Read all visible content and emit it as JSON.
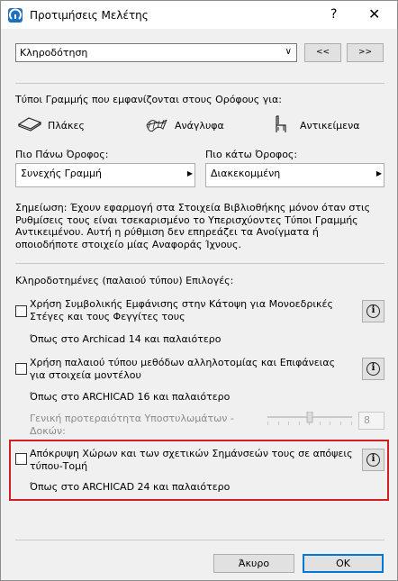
{
  "window": {
    "title": "Προτιμήσεις Μελέτης",
    "help_label": "?",
    "close_label": "✕"
  },
  "page_selector": {
    "value": "Κληροδότηση",
    "prev_label": "<<",
    "next_label": ">>"
  },
  "line_types": {
    "heading": "Τύποι Γραμμής που εμφανίζονται στους Ορόφους για:",
    "elements": [
      {
        "label": "Πλάκες",
        "icon": "slab-icon"
      },
      {
        "label": "Ανάγλυφα",
        "icon": "mesh-icon"
      },
      {
        "label": "Αντικείμενα",
        "icon": "object-icon"
      }
    ],
    "above_label": "Πιο Πάνω Όροφος:",
    "above_value": "Συνεχής Γραμμή",
    "below_label": "Πιο κάτω Όροφος:",
    "below_value": "Διακεκομμένη",
    "note": "Σημείωση: Έχουν εφαρμογή στα Στοιχεία Βιβλιοθήκης μόνον όταν στις Ρυθμίσεις τους είναι τσεκαρισμένο το Υπερισχύοντες Τύποι Γραμμής Αντικειμένου. Αυτή η ρύθμιση δεν επηρεάζει τα Ανοίγματα ή οποιοδήποτε στοιχείο μίας Αναφοράς Ίχνους."
  },
  "legacy": {
    "heading": "Κληροδοτημένες (παλαιού τύπου) Επιλογές:",
    "options": [
      {
        "label": "Χρήση Συμβολικής Εμφάνισης στην Κάτοψη για Μονοεδρικές Στέγες και τους Φεγγίτες τους",
        "version": "Όπως στο Archicad 14 και παλαιότερο",
        "checked": false
      },
      {
        "label": "Χρήση παλαιού τύπου μεθόδων αλληλοτομίας και Επιφάνειας για στοιχεία μοντέλου",
        "version": "Όπως στο ARCHICAD 16 και παλαιότερο",
        "checked": false
      },
      {
        "label": "Απόκρυψη Χώρων και των σχετικών Σημάνσεών τους σε απόψεις τύπου-Τομή",
        "version": "Όπως στο ARCHICAD 24 και παλαιότερο",
        "checked": false
      }
    ],
    "priority_label": "Γενική προτεραιότητα Υποστυλωμάτων - Δοκών:",
    "priority_value": "8",
    "priority_fraction": 0.5
  },
  "footer": {
    "cancel_label": "Άκυρο",
    "ok_label": "OK"
  },
  "colors": {
    "highlight": "#d01f25",
    "accent": "#0078d7"
  }
}
